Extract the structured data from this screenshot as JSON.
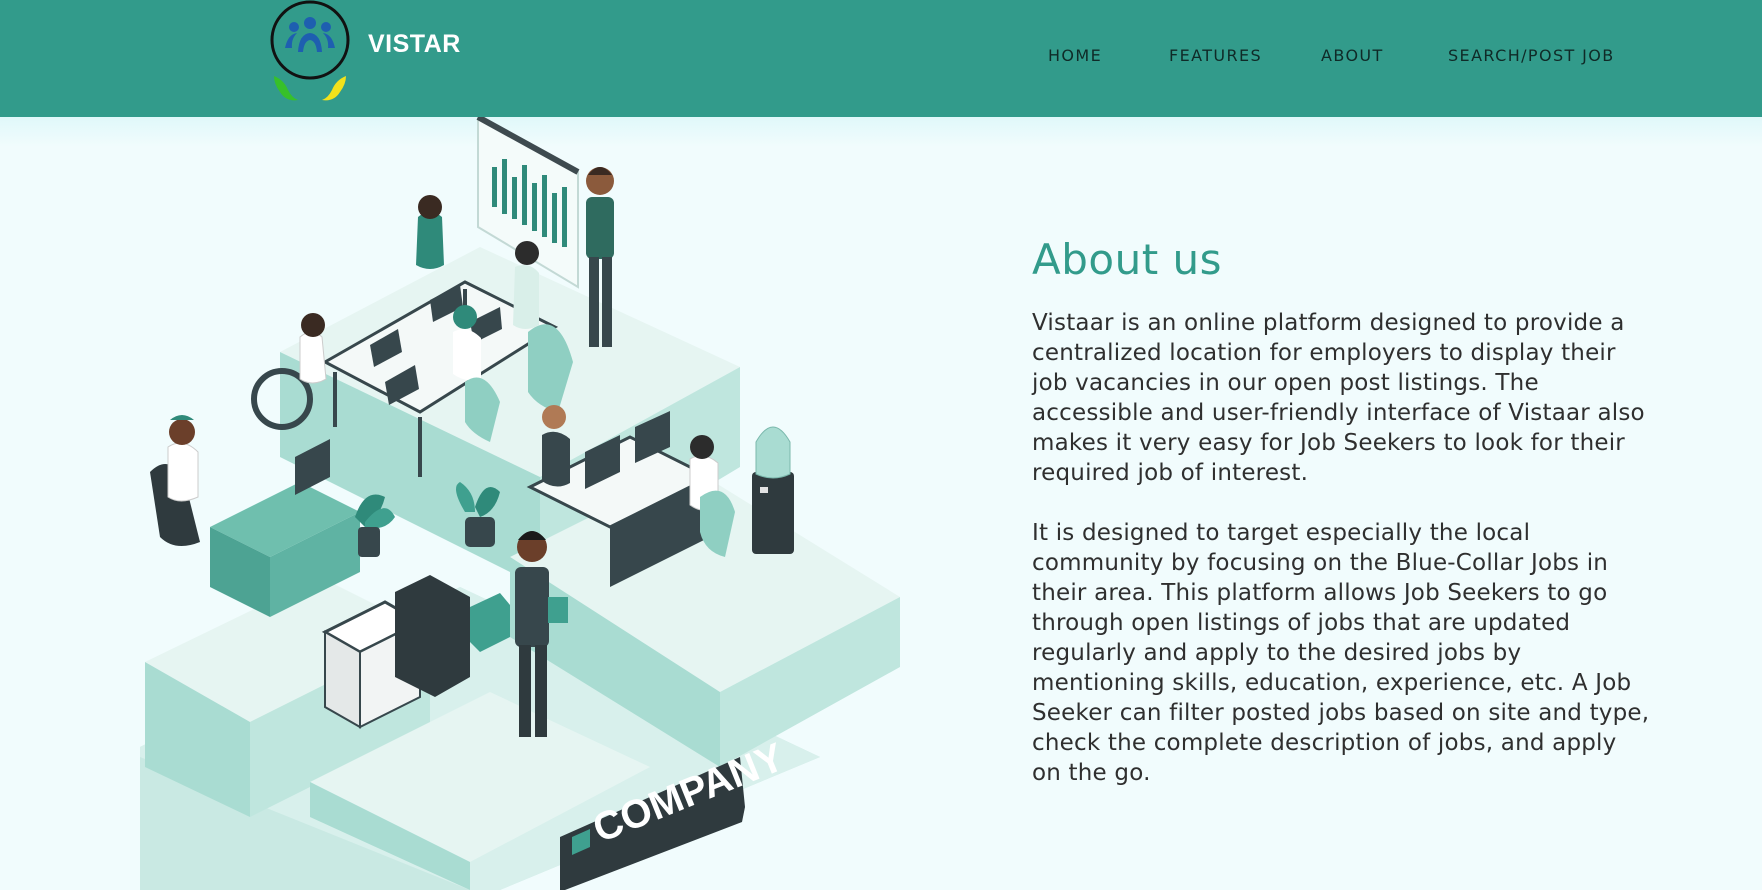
{
  "brand": {
    "name": "VISTAR",
    "logo_icon": "people-hands-logo-icon"
  },
  "nav": {
    "items": [
      {
        "label": "HOME"
      },
      {
        "label": "FEATURES"
      },
      {
        "label": "ABOUT"
      },
      {
        "label": "SEARCH/POST JOB"
      }
    ]
  },
  "illustration": {
    "sign_text": "COMPANY"
  },
  "about": {
    "title": "About us",
    "paragraph1": "Vistaar is an online platform designed to provide a centralized location for employers to display their job vacancies in our open post listings. The accessible and user-friendly interface of Vistaar also makes it very easy for Job Seekers to look for their required job of interest.",
    "paragraph2": "It is designed to target especially the local community by focusing on the Blue-Collar Jobs in their area. This platform allows Job Seekers to go through open listings of jobs that are updated regularly and apply to the desired jobs by mentioning skills, education, experience, etc. A Job Seeker can filter posted jobs based on site and type, check the complete description of jobs, and apply on the go."
  },
  "colors": {
    "navbar": "#329b8b",
    "accent": "#329b8b",
    "background": "#f1fcfd",
    "text": "#2f2f2f"
  }
}
